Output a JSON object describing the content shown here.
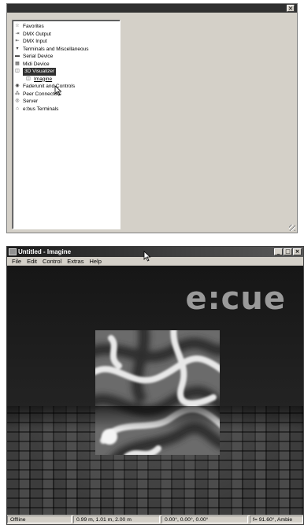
{
  "panel": {
    "close_label": "×",
    "tree": [
      {
        "name": "tree-item-favorites",
        "icon": "star-icon",
        "glyph": "☆",
        "label": "Favorites",
        "child": false,
        "selected": false
      },
      {
        "name": "tree-item-dmx-output",
        "icon": "dmx-output-icon",
        "glyph": "⇥",
        "label": "DMX Output",
        "child": false,
        "selected": false
      },
      {
        "name": "tree-item-dmx-input",
        "icon": "dmx-input-icon",
        "glyph": "⇤",
        "label": "DMX Input",
        "child": false,
        "selected": false
      },
      {
        "name": "tree-item-terminals",
        "icon": "terminal-icon",
        "glyph": "▾",
        "label": "Terminals and Miscellaneous",
        "child": false,
        "selected": false
      },
      {
        "name": "tree-item-serial-device",
        "icon": "serial-device-icon",
        "glyph": "▬",
        "label": "Serial Device",
        "child": false,
        "selected": false
      },
      {
        "name": "tree-item-midi-device",
        "icon": "midi-device-icon",
        "glyph": "▦",
        "label": "Midi Device",
        "child": false,
        "selected": false
      },
      {
        "name": "tree-item-3d-visualizer",
        "icon": "visualizer-icon",
        "glyph": "◫",
        "label": "3D Visualizer",
        "child": false,
        "selected": true
      },
      {
        "name": "tree-item-imagine",
        "icon": "visualizer-icon",
        "glyph": "◫",
        "label": "Imagine",
        "child": true,
        "selected": false
      },
      {
        "name": "tree-item-faderunit",
        "icon": "fader-icon",
        "glyph": "◉",
        "label": "Faderunit and Controls",
        "child": false,
        "selected": false
      },
      {
        "name": "tree-item-peer-connectors",
        "icon": "peers-icon",
        "glyph": "⁂",
        "label": "Peer Connectors",
        "child": false,
        "selected": false
      },
      {
        "name": "tree-item-server",
        "icon": "server-icon",
        "glyph": "◎",
        "label": "Server",
        "child": false,
        "selected": false
      },
      {
        "name": "tree-item-ebus-terminals",
        "icon": "ebus-icon",
        "glyph": "⌂",
        "label": "e:bus Terminals",
        "child": false,
        "selected": false
      }
    ]
  },
  "window": {
    "title": "Untitled - Imagine",
    "buttons": {
      "minimize": "_",
      "maximize": "□",
      "close": "×"
    },
    "menu": [
      "File",
      "Edit",
      "Control",
      "Extras",
      "Help"
    ],
    "logo": "e:cue",
    "status": {
      "state": "Offline",
      "position": "0.99 m,   1.01 m,   2.00 m",
      "rotation": "0.00°,  0.00°,  0.00°",
      "fov": "f= 91.60°, Ambie"
    }
  }
}
